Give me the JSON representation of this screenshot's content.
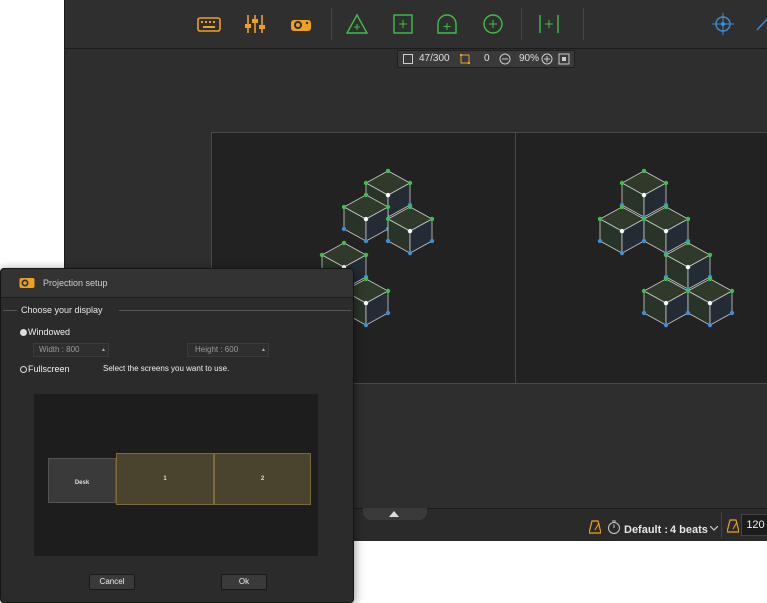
{
  "toolbar": {
    "icons": [
      "keyboard-icon",
      "mixer-sliders-icon",
      "projector-icon",
      "triangle-add-icon",
      "square-add-icon",
      "dome-add-icon",
      "circle-add-icon",
      "column-split-icon",
      "crosshair-icon"
    ]
  },
  "status": {
    "frame_count": "47/300",
    "selection_count": "0",
    "zoom": "90%"
  },
  "bottom_bar": {
    "default_label": "Default :",
    "beats": "4 beats",
    "tempo": "120"
  },
  "dialog": {
    "title": "Projection setup",
    "section": "Choose your display",
    "windowed_label": "Windowed",
    "width_value": "Width : 800",
    "height_value": "Height : 600",
    "fullscreen_label": "Fullscreen",
    "fullscreen_hint": "Select the screens you want to use.",
    "screens": [
      {
        "label": "Desk",
        "selected": false
      },
      {
        "label": "1",
        "selected": true
      },
      {
        "label": "2",
        "selected": true
      }
    ],
    "cancel_label": "Cancel",
    "ok_label": "Ok"
  },
  "colors": {
    "accent_orange": "#f0a020",
    "cube_green": "#3fbf4a",
    "cube_blue": "#3a8fd8",
    "screen_selected": "#4a432e"
  }
}
